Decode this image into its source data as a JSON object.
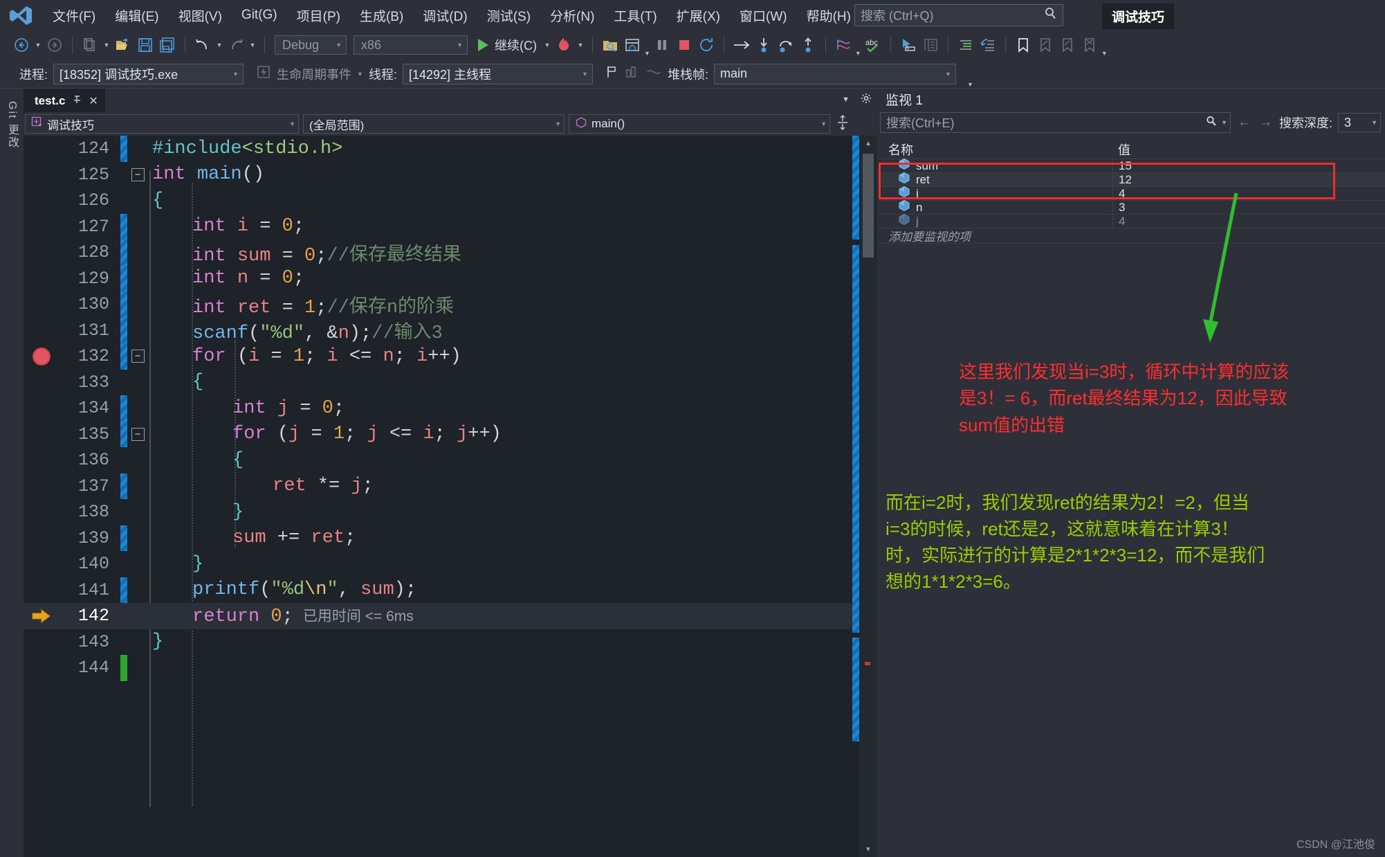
{
  "app": {
    "logo_name": "visual-studio-logo",
    "title_chip": "调试技巧"
  },
  "menubar": {
    "items": [
      {
        "label": "文件(F)"
      },
      {
        "label": "编辑(E)"
      },
      {
        "label": "视图(V)"
      },
      {
        "label": "Git(G)"
      },
      {
        "label": "项目(P)"
      },
      {
        "label": "生成(B)"
      },
      {
        "label": "调试(D)"
      },
      {
        "label": "测试(S)"
      },
      {
        "label": "分析(N)"
      },
      {
        "label": "工具(T)"
      },
      {
        "label": "扩展(X)"
      },
      {
        "label": "窗口(W)"
      },
      {
        "label": "帮助(H)"
      }
    ],
    "search_placeholder": "搜索 (Ctrl+Q)"
  },
  "toolbar": {
    "back_label": "back-navigate",
    "forward_label": "forward-navigate",
    "new_label": "new-item",
    "open_label": "open-file",
    "save_label": "save",
    "save_all_label": "save-all",
    "undo_label": "undo",
    "redo_label": "redo",
    "config": "Debug",
    "platform": "x86",
    "continue_label": "继续(C)",
    "hot_reload_label": "hot-reload",
    "pause_label": "pause",
    "stop_label": "stop",
    "restart_label": "restart",
    "step_over_label": "step-over",
    "step_into_label": "step-into",
    "step_out_label": "step-out"
  },
  "debugbar": {
    "process_label": "进程:",
    "process_value": "[18352] 调试技巧.exe",
    "lifecycle_label": "生命周期事件",
    "thread_label": "线程:",
    "thread_value": "[14292] 主线程",
    "stackframe_label": "堆栈帧:",
    "stackframe_value": "main"
  },
  "git_rail": {
    "label": "Git 更改"
  },
  "editor": {
    "tab_name": "test.c",
    "project_scope": "调试技巧",
    "member_scope": "(全局范围)",
    "function_scope": "main()",
    "elapsed_hint": "已用时间 <= 6ms",
    "lines": [
      {
        "n": "124",
        "change": "blue",
        "fold": "",
        "bp": "",
        "indent": 0,
        "tokens": [
          {
            "t": "#include",
            "c": "pre"
          },
          {
            "t": "<stdio.h>",
            "c": "inc"
          }
        ]
      },
      {
        "n": "125",
        "change": "none",
        "fold": "minus",
        "bp": "",
        "indent": 0,
        "tokens": [
          {
            "t": "int ",
            "c": "ty"
          },
          {
            "t": "main",
            "c": "fn"
          },
          {
            "t": "()",
            "c": "punc"
          }
        ]
      },
      {
        "n": "126",
        "change": "none",
        "fold": "",
        "bp": "",
        "indent": 0,
        "tokens": [
          {
            "t": "{",
            "c": "brc"
          }
        ]
      },
      {
        "n": "127",
        "change": "blue",
        "fold": "",
        "bp": "",
        "indent": 1,
        "tokens": [
          {
            "t": "int ",
            "c": "ty"
          },
          {
            "t": "i ",
            "c": "var"
          },
          {
            "t": "= ",
            "c": "punc"
          },
          {
            "t": "0",
            "c": "num"
          },
          {
            "t": ";",
            "c": "punc"
          }
        ]
      },
      {
        "n": "128",
        "change": "blue",
        "fold": "",
        "bp": "",
        "indent": 1,
        "tokens": [
          {
            "t": "int ",
            "c": "ty"
          },
          {
            "t": "sum ",
            "c": "var"
          },
          {
            "t": "= ",
            "c": "punc"
          },
          {
            "t": "0",
            "c": "num"
          },
          {
            "t": ";",
            "c": "punc"
          },
          {
            "t": "//保存最终结果",
            "c": "cmt"
          }
        ]
      },
      {
        "n": "129",
        "change": "blue",
        "fold": "",
        "bp": "",
        "indent": 1,
        "tokens": [
          {
            "t": "int ",
            "c": "ty"
          },
          {
            "t": "n ",
            "c": "var"
          },
          {
            "t": "= ",
            "c": "punc"
          },
          {
            "t": "0",
            "c": "num"
          },
          {
            "t": ";",
            "c": "punc"
          }
        ]
      },
      {
        "n": "130",
        "change": "blue",
        "fold": "",
        "bp": "",
        "indent": 1,
        "tokens": [
          {
            "t": "int ",
            "c": "ty"
          },
          {
            "t": "ret ",
            "c": "var"
          },
          {
            "t": "= ",
            "c": "punc"
          },
          {
            "t": "1",
            "c": "num"
          },
          {
            "t": ";",
            "c": "punc"
          },
          {
            "t": "//保存n的阶乘",
            "c": "cmt"
          }
        ]
      },
      {
        "n": "131",
        "change": "blue",
        "fold": "",
        "bp": "",
        "indent": 1,
        "tokens": [
          {
            "t": "scanf",
            "c": "fn"
          },
          {
            "t": "(",
            "c": "punc"
          },
          {
            "t": "\"%d\"",
            "c": "str"
          },
          {
            "t": ", &",
            "c": "punc"
          },
          {
            "t": "n",
            "c": "var"
          },
          {
            "t": ");",
            "c": "punc"
          },
          {
            "t": "//输入3",
            "c": "cmt"
          }
        ]
      },
      {
        "n": "132",
        "change": "blue",
        "fold": "minus",
        "bp": "dot",
        "indent": 1,
        "tokens": [
          {
            "t": "for ",
            "c": "kw"
          },
          {
            "t": "(",
            "c": "punc"
          },
          {
            "t": "i ",
            "c": "var"
          },
          {
            "t": "= ",
            "c": "punc"
          },
          {
            "t": "1",
            "c": "num"
          },
          {
            "t": "; ",
            "c": "punc"
          },
          {
            "t": "i ",
            "c": "var"
          },
          {
            "t": "<= ",
            "c": "punc"
          },
          {
            "t": "n",
            "c": "var"
          },
          {
            "t": "; ",
            "c": "punc"
          },
          {
            "t": "i",
            "c": "var"
          },
          {
            "t": "++)",
            "c": "punc"
          }
        ]
      },
      {
        "n": "133",
        "change": "none",
        "fold": "",
        "bp": "",
        "indent": 1,
        "tokens": [
          {
            "t": "{",
            "c": "brc"
          }
        ]
      },
      {
        "n": "134",
        "change": "blue",
        "fold": "",
        "bp": "",
        "indent": 2,
        "tokens": [
          {
            "t": "int ",
            "c": "ty"
          },
          {
            "t": "j ",
            "c": "var"
          },
          {
            "t": "= ",
            "c": "punc"
          },
          {
            "t": "0",
            "c": "num"
          },
          {
            "t": ";",
            "c": "punc"
          }
        ]
      },
      {
        "n": "135",
        "change": "blue",
        "fold": "minus",
        "bp": "",
        "indent": 2,
        "tokens": [
          {
            "t": "for ",
            "c": "kw"
          },
          {
            "t": "(",
            "c": "punc"
          },
          {
            "t": "j ",
            "c": "var"
          },
          {
            "t": "= ",
            "c": "punc"
          },
          {
            "t": "1",
            "c": "num"
          },
          {
            "t": "; ",
            "c": "punc"
          },
          {
            "t": "j ",
            "c": "var"
          },
          {
            "t": "<= ",
            "c": "punc"
          },
          {
            "t": "i",
            "c": "var"
          },
          {
            "t": "; ",
            "c": "punc"
          },
          {
            "t": "j",
            "c": "var"
          },
          {
            "t": "++)",
            "c": "punc"
          }
        ]
      },
      {
        "n": "136",
        "change": "none",
        "fold": "",
        "bp": "",
        "indent": 2,
        "tokens": [
          {
            "t": "{",
            "c": "brc"
          }
        ]
      },
      {
        "n": "137",
        "change": "blue",
        "fold": "",
        "bp": "",
        "indent": 3,
        "tokens": [
          {
            "t": "ret ",
            "c": "var"
          },
          {
            "t": "*= ",
            "c": "punc"
          },
          {
            "t": "j",
            "c": "var"
          },
          {
            "t": ";",
            "c": "punc"
          }
        ]
      },
      {
        "n": "138",
        "change": "none",
        "fold": "",
        "bp": "",
        "indent": 2,
        "tokens": [
          {
            "t": "}",
            "c": "brc"
          }
        ]
      },
      {
        "n": "139",
        "change": "blue",
        "fold": "",
        "bp": "",
        "indent": 2,
        "tokens": [
          {
            "t": "sum ",
            "c": "var"
          },
          {
            "t": "+= ",
            "c": "punc"
          },
          {
            "t": "ret",
            "c": "var"
          },
          {
            "t": ";",
            "c": "punc"
          }
        ]
      },
      {
        "n": "140",
        "change": "none",
        "fold": "",
        "bp": "",
        "indent": 1,
        "tokens": [
          {
            "t": "}",
            "c": "brc"
          }
        ]
      },
      {
        "n": "141",
        "change": "blue",
        "fold": "",
        "bp": "",
        "indent": 1,
        "tokens": [
          {
            "t": "printf",
            "c": "fn"
          },
          {
            "t": "(",
            "c": "punc"
          },
          {
            "t": "\"%d",
            "c": "str"
          },
          {
            "t": "\\n",
            "c": "esc"
          },
          {
            "t": "\"",
            "c": "str"
          },
          {
            "t": ", ",
            "c": "punc"
          },
          {
            "t": "sum",
            "c": "var"
          },
          {
            "t": ");",
            "c": "punc"
          }
        ]
      },
      {
        "n": "142",
        "change": "none",
        "fold": "",
        "bp": "arrow",
        "indent": 1,
        "active": true,
        "tokens": [
          {
            "t": "return ",
            "c": "kw"
          },
          {
            "t": "0",
            "c": "num"
          },
          {
            "t": ";",
            "c": "punc"
          }
        ]
      },
      {
        "n": "143",
        "change": "none",
        "fold": "",
        "bp": "",
        "indent": 0,
        "tokens": [
          {
            "t": "}",
            "c": "brc"
          }
        ]
      },
      {
        "n": "144",
        "change": "green",
        "fold": "",
        "bp": "",
        "indent": 0,
        "tokens": []
      }
    ]
  },
  "watch": {
    "title": "监视 1",
    "search_placeholder": "搜索(Ctrl+E)",
    "depth_label": "搜索深度:",
    "depth_value": "3",
    "columns": [
      "名称",
      "值"
    ],
    "rows": [
      {
        "name": "sum",
        "value": "15",
        "dim": false
      },
      {
        "name": "ret",
        "value": "12",
        "dim": false
      },
      {
        "name": "i",
        "value": "4",
        "dim": false
      },
      {
        "name": "n",
        "value": "3",
        "dim": false
      },
      {
        "name": "j",
        "value": "4",
        "dim": true
      }
    ],
    "add_placeholder": "添加要监视的项"
  },
  "annotations": {
    "red": "这里我们发现当i=3时，循环中计算的应该是3！= 6，而ret最终结果为12，因此导致sum值的出错",
    "green": "而在i=2时，我们发现ret的结果为2！=2，但当i=3的时候，ret还是2，这就意味着在计算3！时，实际进行的计算是2*1*2*3=12，而不是我们想的1*1*2*3=6。"
  },
  "watermark": "CSDN @江池俊",
  "colors": {
    "accent_blue": "#1e86d6",
    "annotation_red": "#ff2d2d",
    "annotation_green": "#9acd00",
    "breakpoint_red": "#e25563",
    "current_line_arrow": "#e8a317"
  }
}
